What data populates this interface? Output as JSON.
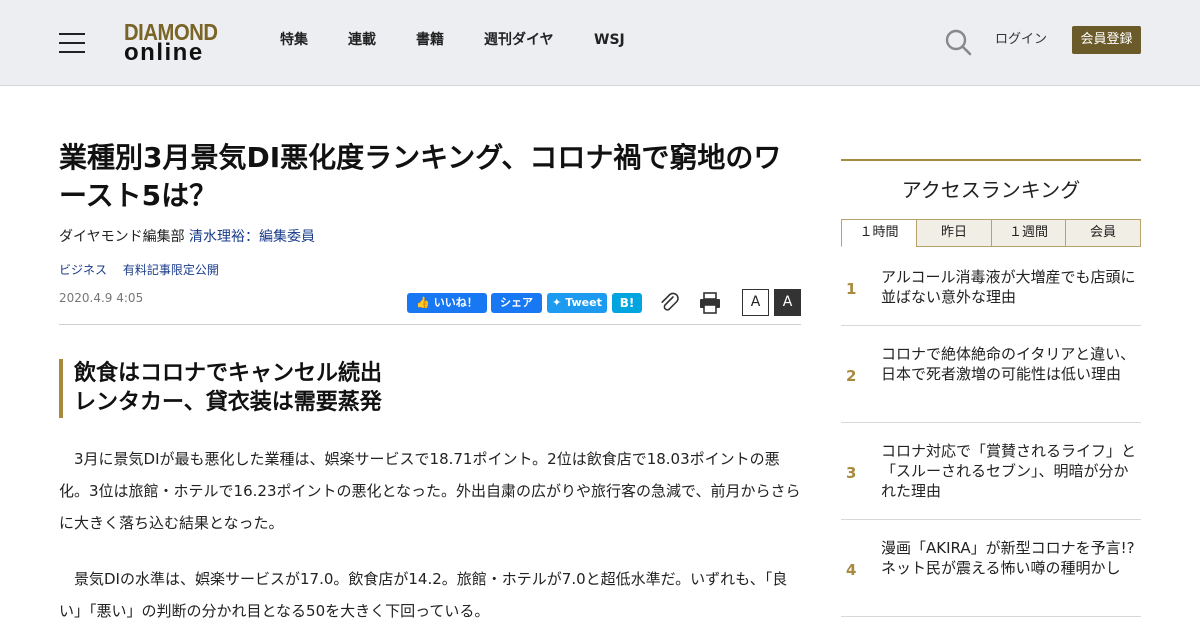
{
  "header": {
    "logo_top": "DIAMOND",
    "logo_bottom": "online",
    "nav": [
      "特集",
      "連載",
      "書籍",
      "週刊ダイヤ",
      "WSJ"
    ],
    "login": "ログイン",
    "register": "会員登録"
  },
  "article": {
    "title": "業種別3月景気DI悪化度ランキング、コロナ禍で窮地のワースト5は？",
    "byline_dept": "ダイヤモンド編集部",
    "byline_author": "清水理裕：編集委員",
    "tags": [
      "ビジネス",
      "有料記事限定公開"
    ],
    "date": "2020.4.9 4:05",
    "share": {
      "fb_like": "いいね！",
      "fb_share": "シェア",
      "tweet": "Tweet",
      "hatena": "B!"
    },
    "font_small": "A",
    "font_large": "A",
    "subhead_line1": "飲食はコロナでキャンセル続出",
    "subhead_line2": "レンタカー、貸衣装は需要蒸発",
    "paragraphs": [
      "3月に景気DIが最も悪化した業種は、娯楽サービスで18.71ポイント。2位は飲食店で18.03ポイントの悪化。3位は旅館・ホテルで16.23ポイントの悪化となった。外出自粛の広がりや旅行客の急減で、前月からさらに大きく落ち込む結果となった。",
      "景気DIの水準は、娯楽サービスが17.0。飲食店が14.2。旅館・ホテルが7.0と超低水準だ。いずれも、「良い」「悪い」の判断の分かれ目となる50を大きく下回っている。"
    ]
  },
  "ranking": {
    "title": "アクセスランキング",
    "tabs": [
      "１時間",
      "昨日",
      "１週間",
      "会員"
    ],
    "items": [
      {
        "num": "1",
        "text": "アルコール消毒液が大増産でも店頭に並ばない意外な理由"
      },
      {
        "num": "2",
        "text": "コロナで絶体絶命のイタリアと違い、日本で死者激増の可能性は低い理由"
      },
      {
        "num": "3",
        "text": "コロナ対応で「賞賛されるライフ」と「スルーされるセブン」、明暗が分かれた理由"
      },
      {
        "num": "4",
        "text": "漫画「AKIRA」が新型コロナを予言!?ネット民が震える怖い噂の種明かし"
      }
    ]
  },
  "colors": {
    "accent": "#a88a3e",
    "header_bg": "#eceef2",
    "link": "#1a3b8a"
  }
}
